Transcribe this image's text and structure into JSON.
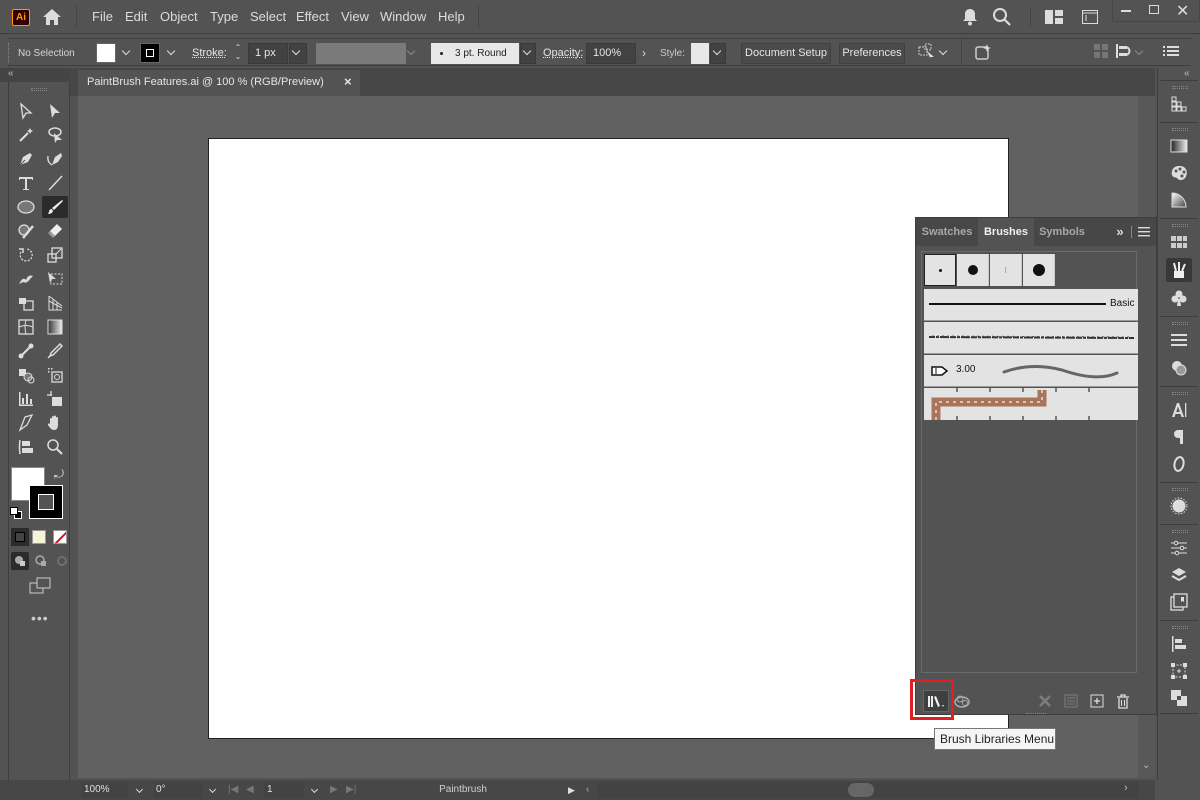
{
  "app": {
    "logo": "Ai",
    "brand_color": "#ff9a00"
  },
  "menu": [
    "File",
    "Edit",
    "Object",
    "Type",
    "Select",
    "Effect",
    "View",
    "Window",
    "Help"
  ],
  "window_controls": [
    "minimize",
    "maximize",
    "close"
  ],
  "control_bar": {
    "selection": "No Selection",
    "stroke_label": "Stroke:",
    "stroke_value": "1 px",
    "brush_value": "3 pt. Round",
    "opacity_label": "Opacity:",
    "opacity_value": "100%",
    "style_label": "Style:",
    "document_setup": "Document Setup",
    "preferences": "Preferences"
  },
  "document_tab": {
    "title": "PaintBrush Features.ai @ 100 % (RGB/Preview)",
    "close": "×"
  },
  "brushes_panel": {
    "tabs": [
      "Swatches",
      "Brushes",
      "Symbols"
    ],
    "active_tab": "Brushes",
    "more": "»",
    "basic_label": "Basic",
    "bristle_size": "3.00",
    "tooltip": "Brush Libraries Menu"
  },
  "status_bar": {
    "zoom": "100%",
    "rotation": "0°",
    "artboard": "1",
    "tool": "Paintbrush"
  }
}
